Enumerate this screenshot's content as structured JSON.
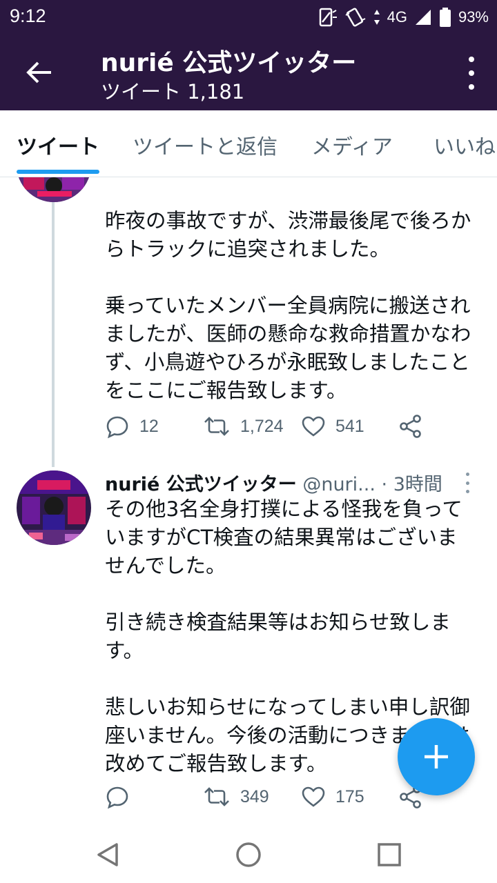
{
  "status_bar": {
    "time": "9:12",
    "network": "4G",
    "battery": "93%"
  },
  "header": {
    "title": "nurié 公式ツイッター",
    "subtitle": "ツイート 1,181"
  },
  "tabs": [
    {
      "label": "ツイート",
      "active": true
    },
    {
      "label": "ツイートと返信",
      "active": false
    },
    {
      "label": "メディア",
      "active": false
    },
    {
      "label": "いいね",
      "active": false
    }
  ],
  "tweets": [
    {
      "text": "昨夜の事故ですが、渋滞最後尾で後ろか\nらトラックに追突されました。\n\n乗っていたメンバー全員病院に搬送され\nましたが、医師の懸命な救命措置かなわ\nず、小鳥遊やひろが永眠致しましたこと\nをここにご報告致します。",
      "replies": "12",
      "retweets": "1,724",
      "likes": "541"
    },
    {
      "name": "nurié 公式ツイッター",
      "handle": "@nuri...",
      "dot": "·",
      "time": "3時間",
      "text": "その他3名全身打撲による怪我を負って\nいますがCT検査の結果異常はございま\nせんでした。\n\n引き続き検査結果等はお知らせ致しま\nす。\n\n悲しいお知らせになってしまい申し訳御\n座いません。今後の活動につきましては\n改めてご報告致します。",
      "replies": "",
      "retweets": "349",
      "likes": "175"
    }
  ],
  "colors": {
    "header_bg": "#2a1740",
    "accent": "#1d9bf0",
    "secondary_text": "#536471"
  }
}
